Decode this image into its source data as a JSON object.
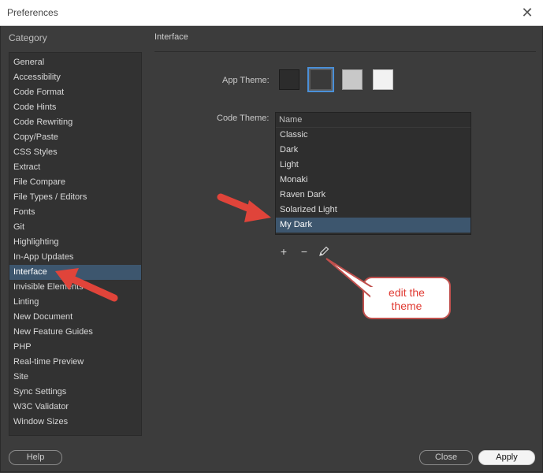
{
  "window": {
    "title": "Preferences"
  },
  "category": {
    "header": "Category",
    "items": [
      "General",
      "Accessibility",
      "Code Format",
      "Code Hints",
      "Code Rewriting",
      "Copy/Paste",
      "CSS Styles",
      "Extract",
      "File Compare",
      "File Types / Editors",
      "Fonts",
      "Git",
      "Highlighting",
      "In-App Updates",
      "Interface",
      "Invisible Elements",
      "Linting",
      "New Document",
      "New Feature Guides",
      "PHP",
      "Real-time Preview",
      "Site",
      "Sync Settings",
      "W3C Validator",
      "Window Sizes"
    ],
    "selected": "Interface"
  },
  "interface": {
    "title": "Interface",
    "app_theme_label": "App Theme:",
    "app_theme_selected": "dark",
    "code_theme_label": "Code Theme:",
    "code_theme_column": "Name",
    "code_themes": [
      "Classic",
      "Dark",
      "Light",
      "Monaki",
      "Raven Dark",
      "Solarized Light",
      "My Dark"
    ],
    "code_theme_selected": "My Dark"
  },
  "tools": {
    "add": "+",
    "remove": "−"
  },
  "annotation": {
    "text": "edit the theme"
  },
  "buttons": {
    "help": "Help",
    "close": "Close",
    "apply": "Apply"
  },
  "colors": {
    "background": "#3c3c3c",
    "selection": "#3d566e",
    "arrow": "#e0443a",
    "accent_border": "#4a90d9"
  },
  "icons": {
    "close": "close-icon",
    "edit": "pencil-icon"
  }
}
